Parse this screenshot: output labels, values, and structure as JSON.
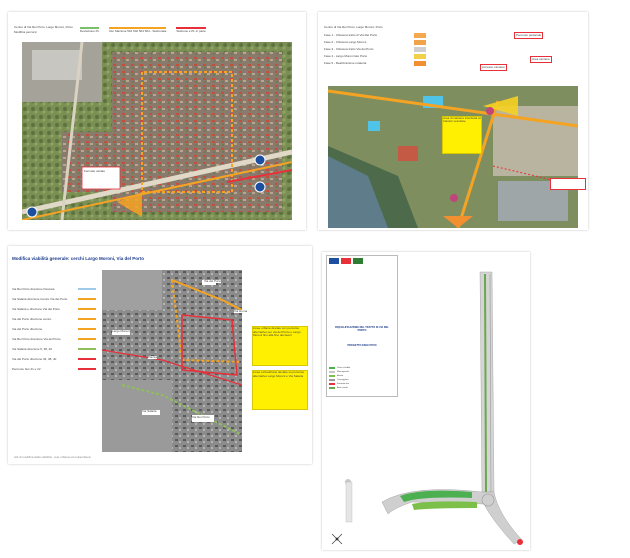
{
  "page1": {
    "header_left_1": "Centro di Via Rei Porto, Largo Moroni, Porto",
    "header_left_2": "Modifica percorsi",
    "legend": [
      "Deviazione PL",
      "Rei Stazione 501 502 503 504 - Stazionale",
      "Stazione e PL in parte"
    ],
    "callout": "Fermate variate",
    "colors": {
      "orange": "#f5a323",
      "red": "#e8303a",
      "blue": "#1c4fa0"
    }
  },
  "page2": {
    "header": "Centro di Via Rei Porto, Largo Moroni, Porto",
    "steps": [
      "Fase 1 - Chiusura tratto di Via Rei Porto",
      "Fase 2 - Chiusura Largo Moroni",
      "Fase 3 - Chiusura tratto Via del Porto",
      "Fase 4 - Largo Moroni lato Porto",
      "Fase 5 - Realizzazione rotatoria"
    ],
    "swatch_colors": [
      "#f4a950",
      "#f2a24a",
      "#cfcfcf",
      "#f1d14a",
      "#f28f2e"
    ],
    "callouts": [
      "Accesso cantiere",
      "Percorso pedonale",
      "Area cantiere"
    ],
    "yellow_note": "Area di cantiere interdetta al transito veicolare"
  },
  "page3": {
    "title": "Modifica viabilità generale: cerchi Largo Moroni, Via del Porto",
    "legend": [
      "Via Rei Porto direzione Pescara",
      "Via Salaria direzione Centro Via del Porto",
      "Via Salaria e direzione Via del Porto",
      "Via del Porto direzione centro",
      "Via del Porto direzione",
      "Via Rei Porto direzione Via del Porto",
      "Via Salaria direzione 5, 38, 40",
      "Via del Porto direzione 36, 38, 40",
      "Percorso bus 21 e 22"
    ],
    "legend_colors": [
      "#9ec9e8",
      "#f5a323",
      "#f5a323",
      "#f5a323",
      "#f5a323",
      "#f5a323",
      "#8fbf5a",
      "#e8303a",
      "#e8303a"
    ],
    "note1": "Linee urbane deviate con percorso alternativo per via del Porto e Largo Moroni fino alla fine dei lavori",
    "note2": "Linee extraurbane deviate su percorso alternativo Largo Moroni e Via Salaria",
    "map_labels": [
      "Via del Porto",
      "Largo Moroni",
      "Via Salaria",
      "Via Rei Porto",
      "Via Roma",
      "Piazza"
    ],
    "footer": "Atti di modifica della viabilità - rete urbana ed extraurbana"
  },
  "page4": {
    "project_title": "RIQUALIFICAZIONE DEL TRATTO DI VIA DEL PORTO",
    "project_sub": "PROGETTO ESECUTIVO",
    "legend": [
      "Pista ciclabile",
      "Marciapiede",
      "Aiuola",
      "Carreggiata",
      "Fermata bus",
      "Area verde",
      "Illuminazione",
      "Segnaletica"
    ],
    "legend_colors": [
      "#4caf50",
      "#c8c8c8",
      "#7cc04a",
      "#9a9a9a",
      "#e8303a",
      "#6aa84f",
      "#f5a323",
      "#1c4fa0"
    ]
  }
}
